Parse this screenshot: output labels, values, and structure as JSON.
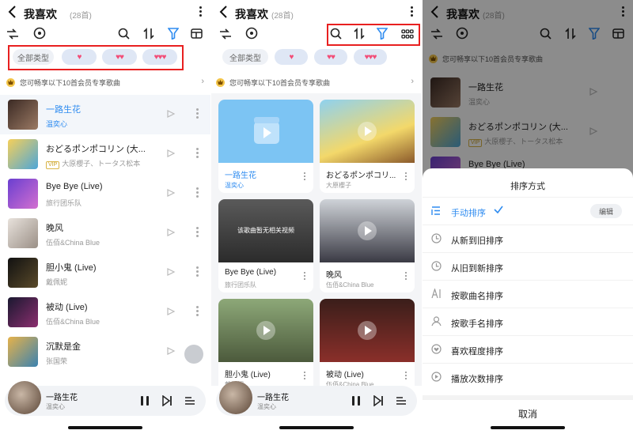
{
  "header": {
    "title": "我喜欢",
    "count": "(28首)"
  },
  "chips": {
    "all": "全部类型",
    "one": "♥",
    "two": "♥♥",
    "three": "♥♥♥"
  },
  "vip_notice": "您可畅享以下10首会员专享歌曲",
  "songs": [
    {
      "title": "一路生花",
      "artist": "温奕心",
      "selected": true
    },
    {
      "title": "おどるポンポコリン (大...",
      "artist": "大原櫻子、トータス松本",
      "vip": "VIP"
    },
    {
      "title": "Bye Bye (Live)",
      "artist": "旅行团乐队"
    },
    {
      "title": "晚风",
      "artist": "伍佰&China Blue"
    },
    {
      "title": "胆小鬼 (Live)",
      "artist": "戴佩妮"
    },
    {
      "title": "被动 (Live)",
      "artist": "伍佰&China Blue"
    },
    {
      "title": "沉默是金",
      "artist": "张国荣"
    }
  ],
  "grid": [
    {
      "title": "一路生花",
      "artist": "温奕心"
    },
    {
      "title": "おどるポンポコリ...",
      "artist": "大原櫻子"
    },
    {
      "title": "Bye Bye (Live)",
      "artist": "旅行团乐队",
      "no_video": "该歌曲暂无相关视频"
    },
    {
      "title": "晚风",
      "artist": "伍佰&China Blue"
    },
    {
      "title": "胆小鬼 (Live)",
      "artist": "戴佩妮"
    },
    {
      "title": "被动 (Live)",
      "artist": "伍佰&China Blue"
    }
  ],
  "panel3_songs": [
    {
      "title": "一路生花",
      "artist": "温奕心"
    },
    {
      "title": "おどるポンポコリン (大...",
      "artist": "大原櫻子、トータス松本",
      "vip": "VIP"
    },
    {
      "title": "Bye Bye (Live)",
      "artist": ""
    }
  ],
  "player": {
    "title": "一路生花",
    "artist": "温奕心"
  },
  "sort_sheet": {
    "title": "排序方式",
    "edit": "编辑",
    "cancel": "取消",
    "options": [
      "手动排序",
      "从新到旧排序",
      "从旧到新排序",
      "按歌曲名排序",
      "按歌手名排序",
      "喜欢程度排序",
      "播放次数排序"
    ]
  },
  "colors": {
    "accent": "#2f8cf0",
    "heart": "#f24d77",
    "highlight": "#e82020"
  }
}
